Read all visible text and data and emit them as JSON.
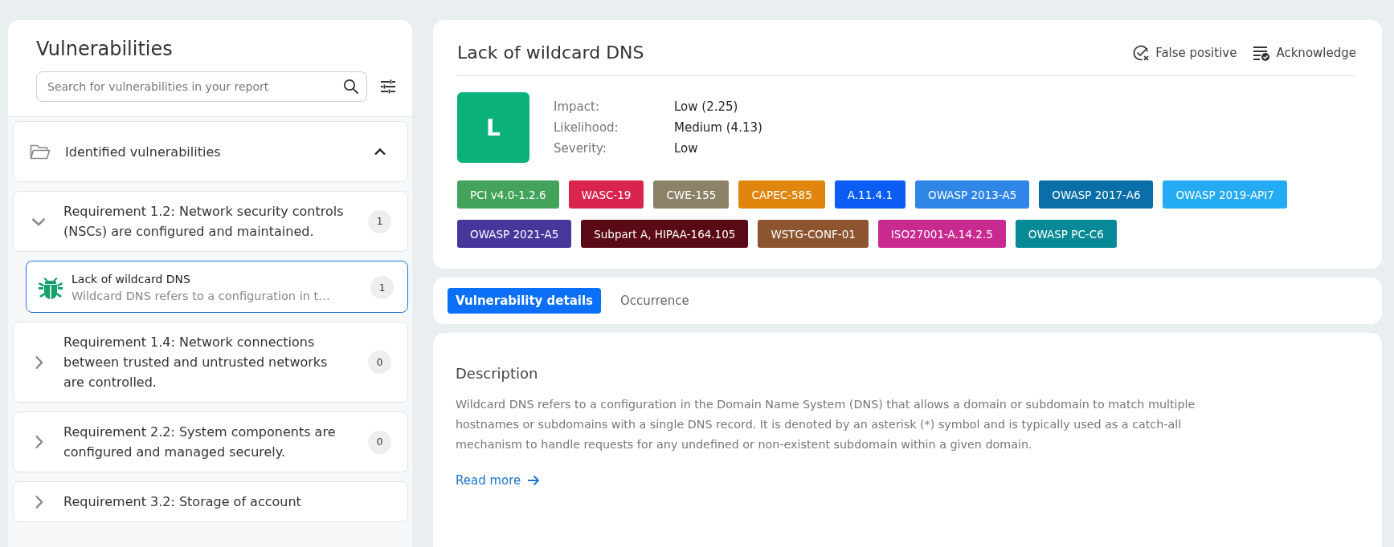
{
  "sidebar": {
    "title": "Vulnerabilities",
    "search": {
      "placeholder": "Search for vulnerabilities in your report"
    },
    "groups": [
      {
        "label": "Identified vulnerabilities",
        "expanded": true,
        "requirements": [
          {
            "title": "Requirement 1.2: Network security controls (NSCs) are configured and maintained.",
            "count": "1",
            "expanded": true,
            "findings": [
              {
                "title": "Lack of wildcard DNS",
                "summary": "Wildcard DNS refers to a configuration in t…",
                "count": "1",
                "selected": true
              }
            ]
          },
          {
            "title": "Requirement 1.4: Network connections between trusted and untrusted networks are controlled.",
            "count": "0",
            "expanded": false
          },
          {
            "title": "Requirement 2.2: System components are configured and managed securely.",
            "count": "0",
            "expanded": false
          },
          {
            "title": "Requirement 3.2: Storage of account",
            "expanded": false
          }
        ]
      }
    ]
  },
  "detail": {
    "title": "Lack of wildcard DNS",
    "actions": [
      {
        "label": "False positive",
        "kind": "false-positive"
      },
      {
        "label": "Acknowledge",
        "kind": "acknowledge"
      }
    ],
    "risk": {
      "letter": "L",
      "color": "#0bb07b"
    },
    "metrics": [
      {
        "label": "Impact:",
        "value": "Low (2.25)"
      },
      {
        "label": "Likelihood:",
        "value": "Medium (4.13)"
      },
      {
        "label": "Severity:",
        "value": "Low"
      }
    ],
    "tags": [
      {
        "label": "PCI v4.0-1.2.6",
        "color": "#43a35a"
      },
      {
        "label": "WASC-19",
        "color": "#d9254e"
      },
      {
        "label": "CWE-155",
        "color": "#8c8268"
      },
      {
        "label": "CAPEC-585",
        "color": "#e0860f"
      },
      {
        "label": "A.11.4.1",
        "color": "#0a5cf5"
      },
      {
        "label": "OWASP 2013-A5",
        "color": "#2f86e6"
      },
      {
        "label": "OWASP 2017-A6",
        "color": "#0a6fa8"
      },
      {
        "label": "OWASP 2019-API7",
        "color": "#25aaf4"
      },
      {
        "label": "OWASP 2021-A5",
        "color": "#46379b"
      },
      {
        "label": "Subpart A, HIPAA-164.105",
        "color": "#5a0a14"
      },
      {
        "label": "WSTG-CONF-01",
        "color": "#8c5530"
      },
      {
        "label": "ISO27001-A.14.2.5",
        "color": "#c82a8f"
      },
      {
        "label": "OWASP PC-C6",
        "color": "#088a96"
      }
    ]
  },
  "tabs": [
    {
      "label": "Vulnerability details",
      "selected": true
    },
    {
      "label": "Occurrence",
      "selected": false
    }
  ],
  "description": {
    "heading": "Description",
    "text": "Wildcard DNS refers to a configuration in the Domain Name System (DNS) that allows a domain or subdomain to match multiple hostnames or subdomains with a single DNS record. It is denoted by an asterisk (*) symbol and is typically used as a catch-all mechanism to handle requests for any undefined or non-existent subdomain within a given domain.",
    "link": "Read more"
  }
}
